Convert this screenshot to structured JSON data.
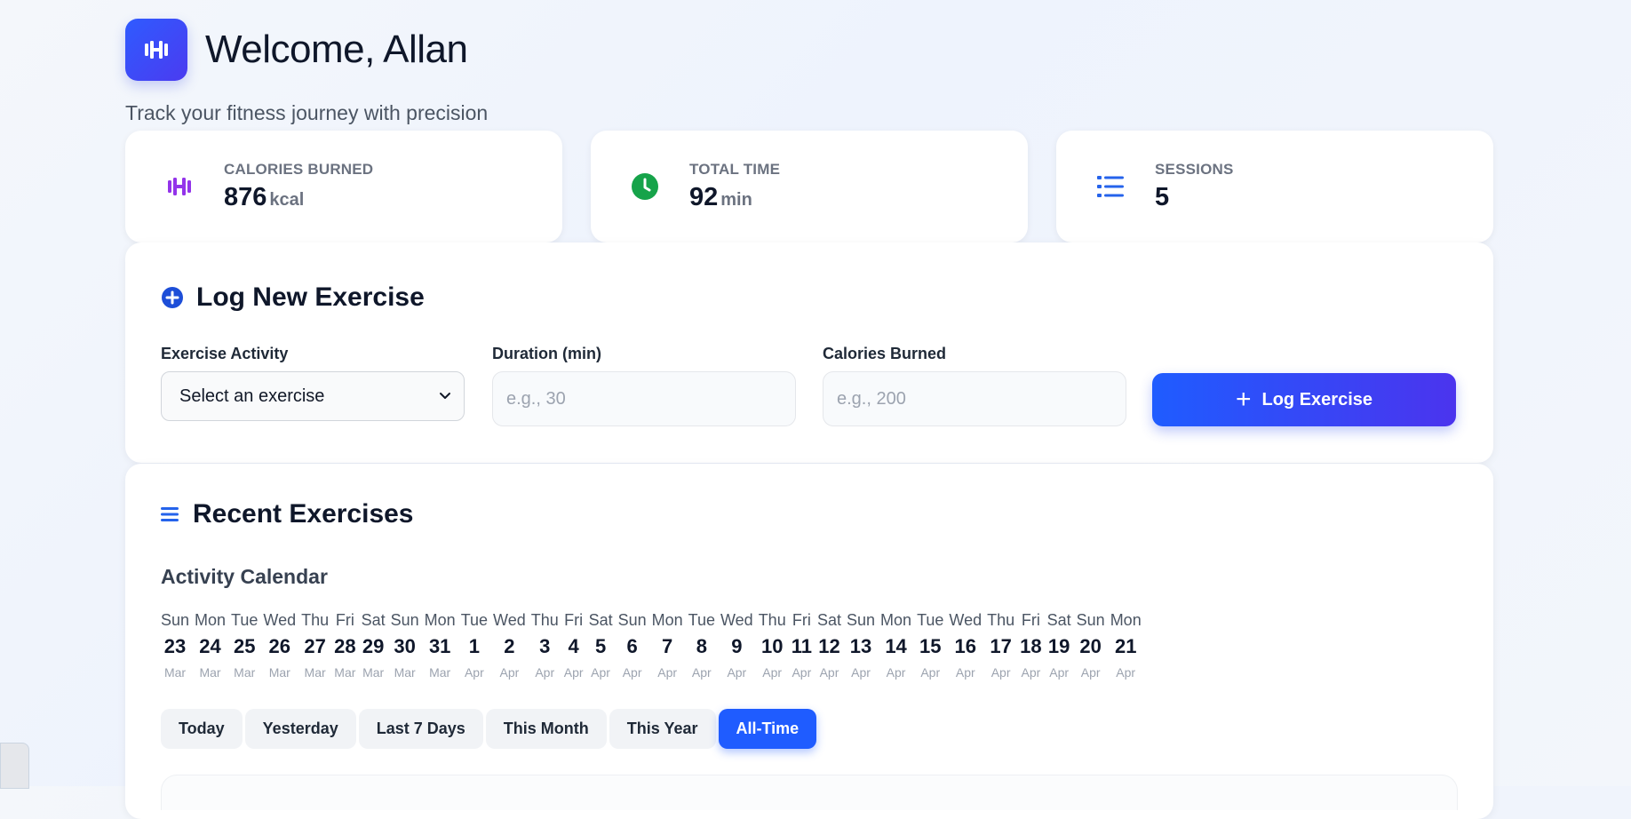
{
  "header": {
    "welcome": "Welcome, Allan",
    "subtitle": "Track your fitness journey with precision",
    "logo_icon": "dumbbell-icon"
  },
  "stats": [
    {
      "label": "CALORIES BURNED",
      "value": "876",
      "unit": "kcal",
      "icon": "dumbbell-icon",
      "color": "#9333ea"
    },
    {
      "label": "TOTAL TIME",
      "value": "92",
      "unit": "min",
      "icon": "clock-icon",
      "color": "#16a34a"
    },
    {
      "label": "SESSIONS",
      "value": "5",
      "unit": "",
      "icon": "list-icon",
      "color": "#2563eb"
    }
  ],
  "log_form": {
    "title": "Log New Exercise",
    "activity_label": "Exercise Activity",
    "activity_value": "Select an exercise",
    "duration_label": "Duration (min)",
    "duration_placeholder": "e.g., 30",
    "calories_label": "Calories Burned",
    "calories_placeholder": "e.g., 200",
    "submit_label": "Log Exercise"
  },
  "recent": {
    "title": "Recent Exercises",
    "calendar_title": "Activity Calendar",
    "days": [
      {
        "dow": "Sun",
        "num": "23",
        "mon": "Mar"
      },
      {
        "dow": "Mon",
        "num": "24",
        "mon": "Mar"
      },
      {
        "dow": "Tue",
        "num": "25",
        "mon": "Mar"
      },
      {
        "dow": "Wed",
        "num": "26",
        "mon": "Mar"
      },
      {
        "dow": "Thu",
        "num": "27",
        "mon": "Mar"
      },
      {
        "dow": "Fri",
        "num": "28",
        "mon": "Mar"
      },
      {
        "dow": "Sat",
        "num": "29",
        "mon": "Mar"
      },
      {
        "dow": "Sun",
        "num": "30",
        "mon": "Mar"
      },
      {
        "dow": "Mon",
        "num": "31",
        "mon": "Mar"
      },
      {
        "dow": "Tue",
        "num": "1",
        "mon": "Apr"
      },
      {
        "dow": "Wed",
        "num": "2",
        "mon": "Apr"
      },
      {
        "dow": "Thu",
        "num": "3",
        "mon": "Apr"
      },
      {
        "dow": "Fri",
        "num": "4",
        "mon": "Apr"
      },
      {
        "dow": "Sat",
        "num": "5",
        "mon": "Apr"
      },
      {
        "dow": "Sun",
        "num": "6",
        "mon": "Apr"
      },
      {
        "dow": "Mon",
        "num": "7",
        "mon": "Apr"
      },
      {
        "dow": "Tue",
        "num": "8",
        "mon": "Apr"
      },
      {
        "dow": "Wed",
        "num": "9",
        "mon": "Apr"
      },
      {
        "dow": "Thu",
        "num": "10",
        "mon": "Apr"
      },
      {
        "dow": "Fri",
        "num": "11",
        "mon": "Apr"
      },
      {
        "dow": "Sat",
        "num": "12",
        "mon": "Apr"
      },
      {
        "dow": "Sun",
        "num": "13",
        "mon": "Apr"
      },
      {
        "dow": "Mon",
        "num": "14",
        "mon": "Apr"
      },
      {
        "dow": "Tue",
        "num": "15",
        "mon": "Apr"
      },
      {
        "dow": "Wed",
        "num": "16",
        "mon": "Apr"
      },
      {
        "dow": "Thu",
        "num": "17",
        "mon": "Apr"
      },
      {
        "dow": "Fri",
        "num": "18",
        "mon": "Apr"
      },
      {
        "dow": "Sat",
        "num": "19",
        "mon": "Apr"
      },
      {
        "dow": "Sun",
        "num": "20",
        "mon": "Apr"
      },
      {
        "dow": "Mon",
        "num": "21",
        "mon": "Apr"
      }
    ],
    "filters": [
      "Today",
      "Yesterday",
      "Last 7 Days",
      "This Month",
      "This Year",
      "All-Time"
    ],
    "active_filter": "All-Time"
  },
  "colors": {
    "accent": "#1f5cff",
    "accent_end": "#4b34ee"
  }
}
